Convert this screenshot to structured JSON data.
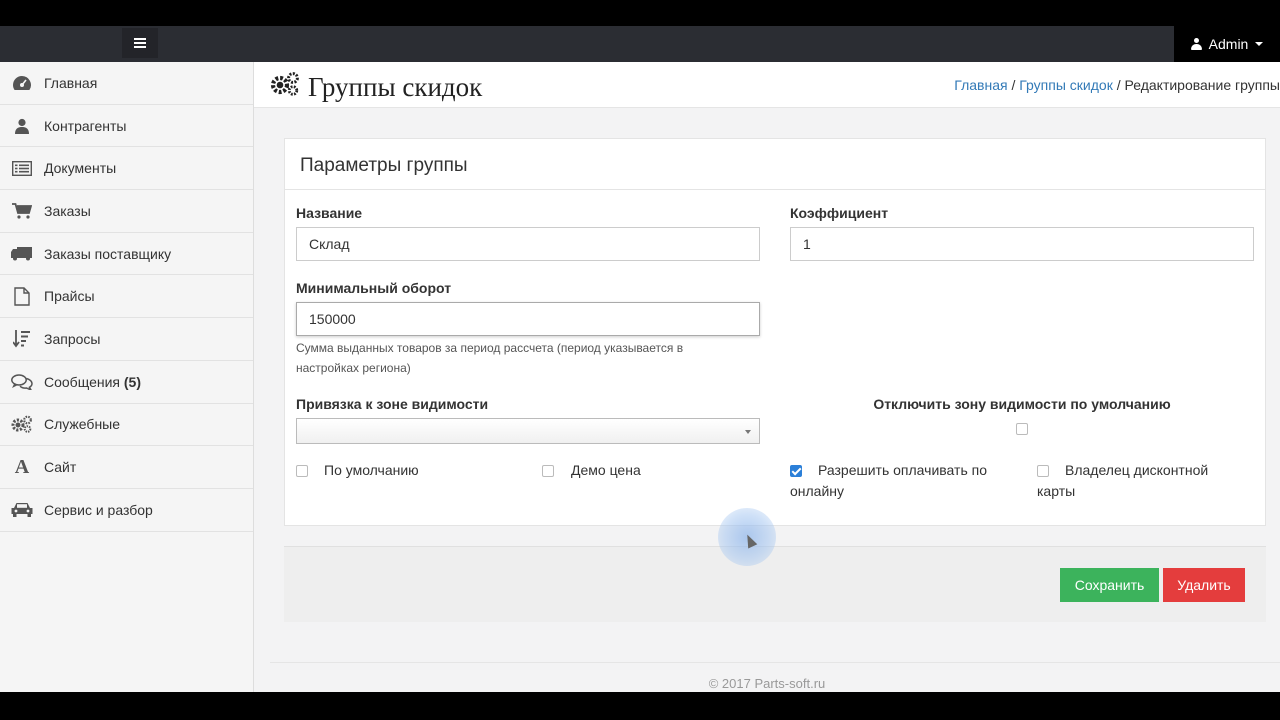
{
  "navbar": {
    "user_label": "Admin"
  },
  "sidebar": {
    "items": [
      {
        "label": "Главная",
        "icon": "dashboard-icon"
      },
      {
        "label": "Контрагенты",
        "icon": "user-icon"
      },
      {
        "label": "Документы",
        "icon": "list-icon"
      },
      {
        "label": "Заказы",
        "icon": "cart-icon"
      },
      {
        "label": "Заказы поставщику",
        "icon": "truck-icon"
      },
      {
        "label": "Прайсы",
        "icon": "file-icon"
      },
      {
        "label": "Запросы",
        "icon": "sort-icon"
      },
      {
        "label": "Сообщения",
        "badge": "(5)",
        "icon": "comments-icon"
      },
      {
        "label": "Служебные",
        "icon": "gears-icon"
      },
      {
        "label": "Сайт",
        "icon": "font-icon"
      },
      {
        "label": "Сервис и разбор",
        "icon": "car-icon"
      }
    ]
  },
  "header": {
    "title": "Группы скидок",
    "breadcrumb": {
      "home": "Главная",
      "section": "Группы скидок",
      "separator": "/",
      "current": "Редактирование группы"
    }
  },
  "panel": {
    "title": "Параметры группы",
    "name_label": "Название",
    "name_value": "Склад",
    "coef_label": "Коэффициент",
    "coef_value": "1",
    "min_turnover_label": "Минимальный оборот",
    "min_turnover_value": "150000",
    "min_turnover_help": "Сумма выданных товаров за период рассчета (период указывается в настройках региона)",
    "visibility_label": "Привязка к зоне видимости",
    "visibility_value": "",
    "disable_visibility_label": "Отключить зону видимости по умолчанию",
    "checkboxes": [
      {
        "label": "По умолчанию",
        "checked": false
      },
      {
        "label": "Демо цена",
        "checked": false
      },
      {
        "label": "Разрешить оплачивать по онлайну",
        "checked": true
      },
      {
        "label": "Владелец дисконтной карты",
        "checked": false
      }
    ]
  },
  "actions": {
    "save_label": "Сохранить",
    "delete_label": "Удалить"
  },
  "footer": {
    "copyright": "© 2017 Parts-soft.ru"
  },
  "colors": {
    "navbar": "#2b2d33",
    "save": "#3cb35c",
    "delete": "#e43d3d",
    "link": "#337ab7"
  }
}
